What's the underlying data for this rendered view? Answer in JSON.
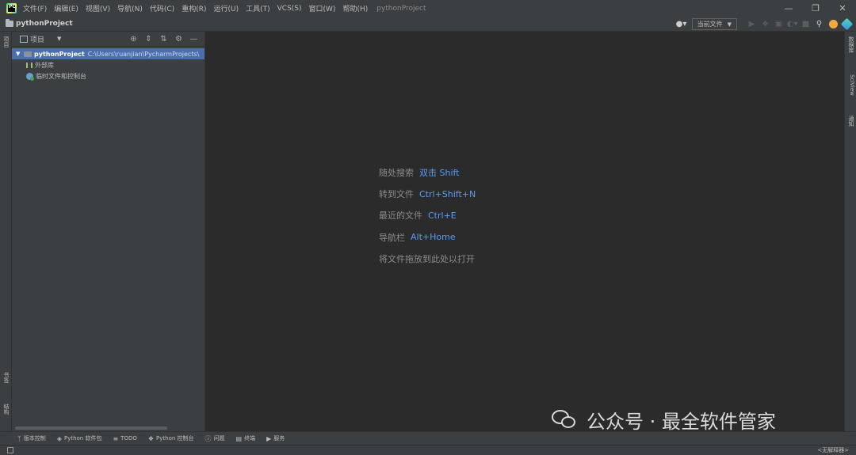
{
  "titlebar": {
    "menu": [
      "文件(F)",
      "编辑(E)",
      "视图(V)",
      "导航(N)",
      "代码(C)",
      "重构(R)",
      "运行(U)",
      "工具(T)",
      "VCS(S)",
      "窗口(W)",
      "帮助(H)"
    ],
    "window_title": "pythonProject"
  },
  "navbar": {
    "project": "pythonProject",
    "run_config": "当前文件"
  },
  "left_strip": {
    "project": "项目",
    "structure": "结构",
    "bookmarks": "书签"
  },
  "right_strip": {
    "database": "数据库",
    "sciview": "SciView",
    "notifications": "通知"
  },
  "project_panel": {
    "title": "项目",
    "tree": {
      "root_name": "pythonProject",
      "root_path": "C:\\Users\\ruanjian\\PycharmProjects\\",
      "external_libs": "外部库",
      "scratches": "临时文件和控制台"
    }
  },
  "editor_hints": [
    {
      "label": "随处搜索",
      "key": "双击 Shift"
    },
    {
      "label": "转到文件",
      "key": "Ctrl+Shift+N"
    },
    {
      "label": "最近的文件",
      "key": "Ctrl+E"
    },
    {
      "label": "导航栏",
      "key": "Alt+Home"
    },
    {
      "label": "将文件拖放到此处以打开",
      "key": ""
    }
  ],
  "bottombar": [
    "版本控制",
    "Python 软件包",
    "TODO",
    "Python 控制台",
    "问题",
    "终端",
    "服务"
  ],
  "statusbar": {
    "interpreter": "<无解释器>"
  },
  "watermark": {
    "text": "公众号 · 最全软件管家"
  }
}
